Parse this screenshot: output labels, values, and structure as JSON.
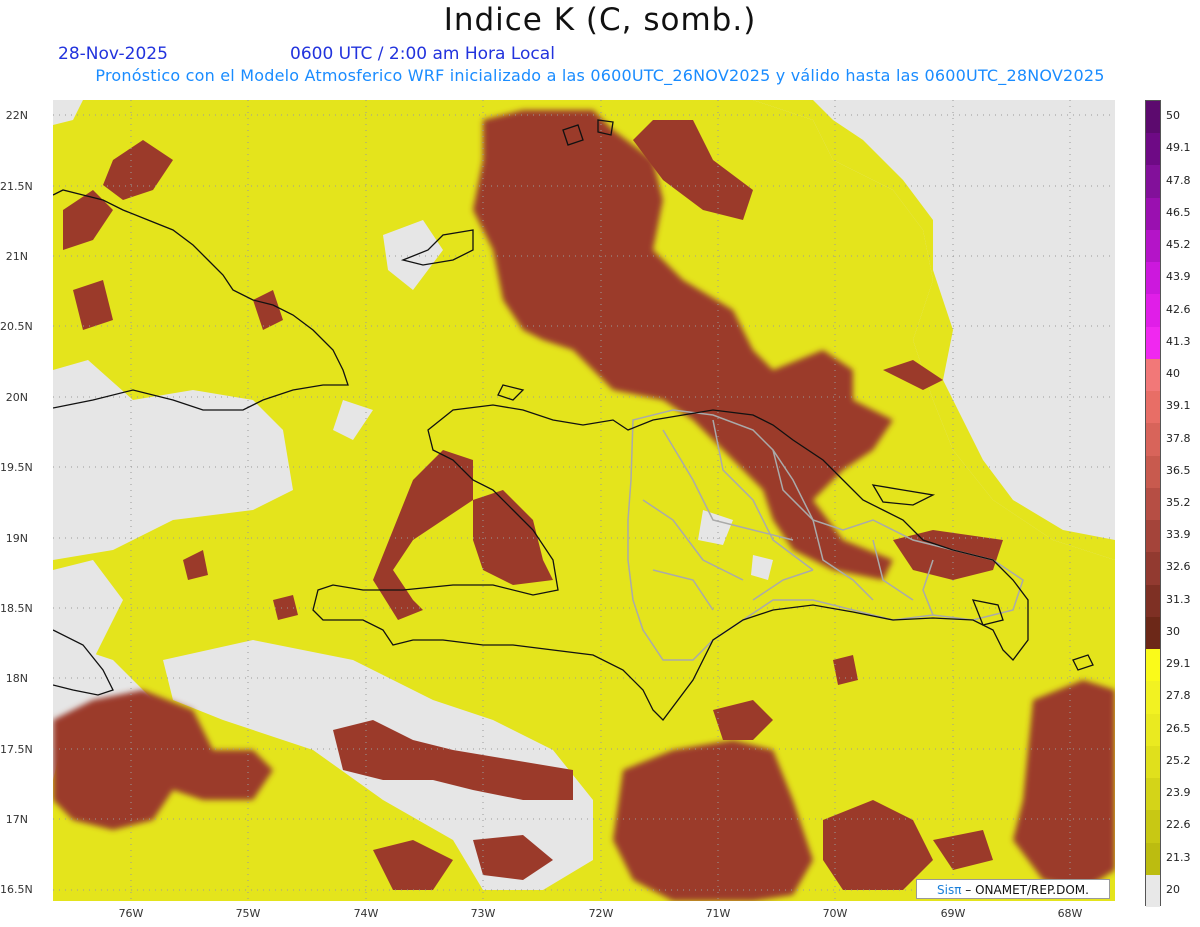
{
  "title": "Indice K (C, somb.)",
  "date": "28-Nov-2025",
  "valid_time": "0600 UTC / 2:00 am Hora Local",
  "forecast_text": "Pronóstico con el Modelo Atmosferico WRF inicializado a las 0600UTC_26NOV2025 y válido hasta las  0600UTC_28NOV2025",
  "lat_labels": [
    "22N",
    "21.5N",
    "21N",
    "20.5N",
    "20N",
    "19.5N",
    "19N",
    "18.5N",
    "18N",
    "17.5N",
    "17N",
    "16.5N"
  ],
  "lon_labels": [
    "76W",
    "75W",
    "74W",
    "73W",
    "72W",
    "71W",
    "70W",
    "69W",
    "68W"
  ],
  "colorbar": {
    "labels": [
      "50",
      "49.1",
      "47.8",
      "46.5",
      "45.2",
      "43.9",
      "42.6",
      "41.3",
      "40",
      "39.1",
      "37.8",
      "36.5",
      "35.2",
      "33.9",
      "32.6",
      "31.3",
      "30",
      "29.1",
      "27.8",
      "26.5",
      "25.2",
      "23.9",
      "22.6",
      "21.3",
      "20"
    ],
    "colors": [
      "#5c0a6e",
      "#6e0a85",
      "#82109a",
      "#9a10b0",
      "#b414c8",
      "#cc18dd",
      "#e01ee8",
      "#f028f0",
      "#f27878",
      "#e86e66",
      "#d8645a",
      "#c85a4e",
      "#b64e44",
      "#a4443a",
      "#923a30",
      "#7e3024",
      "#6c2818",
      "#fafa1a",
      "#f2f222",
      "#eaea20",
      "#e0e01c",
      "#d4d418",
      "#c8c814",
      "#bcbc10",
      "#e8e8e8"
    ]
  },
  "credit_brand": "Sisπ",
  "credit_text": "– ONAMET/REP.DOM.",
  "colors": {
    "background_no_data": "#e6e6e6",
    "k_low": "#e8e81e",
    "k_high": "#9a3a2a",
    "coastline": "#111111",
    "provinces": "#aaaaaa"
  }
}
